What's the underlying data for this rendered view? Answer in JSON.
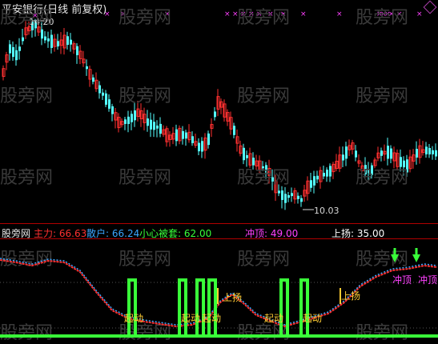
{
  "window": {
    "title": "平安银行(日线 前复权)"
  },
  "watermark_text": "股旁网",
  "price_panel": {
    "high_label": "14.20",
    "low_label": "10.03",
    "up_color": "#ff3030",
    "down_color": "#54ffff"
  },
  "indicator_panel": {
    "name": "股旁网",
    "items": [
      {
        "label": "主力:",
        "value": "66.63",
        "color": "#ff3030"
      },
      {
        "label": "散户:",
        "value": "66.24",
        "color": "#3aa6ff"
      },
      {
        "label": "小心被套:",
        "value": "62.00",
        "color": "#39ff39"
      },
      {
        "label": "冲顶:",
        "value": "49.00",
        "color": "#ff40ff"
      },
      {
        "label": "上扬:",
        "value": "35.00",
        "color": "#ffffff"
      }
    ],
    "annotations": {
      "qidong": "起动",
      "shangyang": "上扬",
      "chongding": "冲顶"
    }
  }
}
